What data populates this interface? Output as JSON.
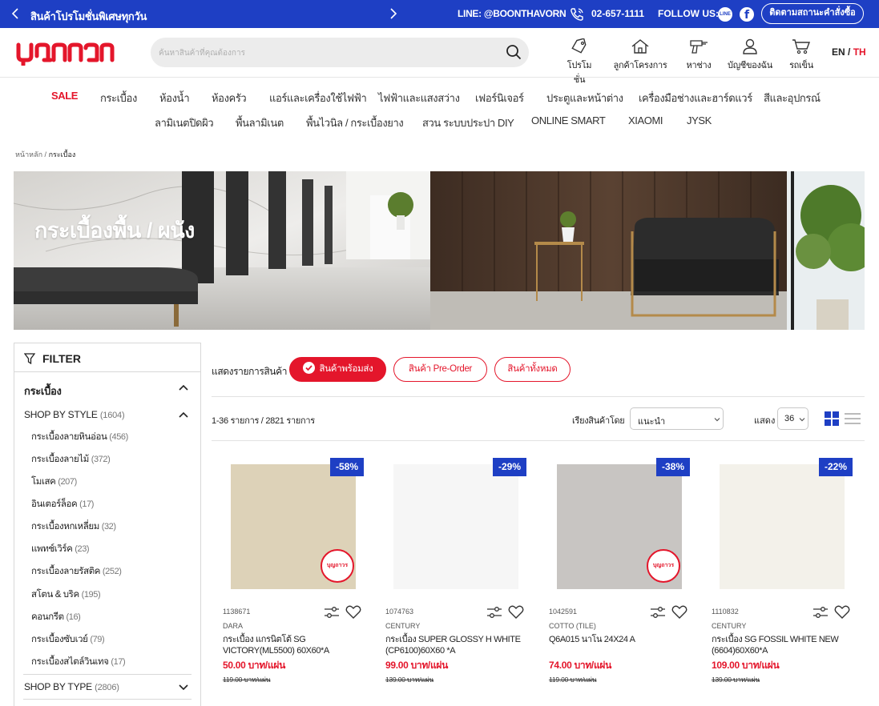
{
  "topbar": {
    "promo": "สินค้าโปรโมชั่นพิเศษทุกวัน",
    "line_id": "LINE: @BOONTHAVORN",
    "phone": "02-657-1111",
    "follow_label": "FOLLOW US:",
    "line_icon_text": "LINE",
    "track_order": "ติดตามสถานะคำสั่งซื้อ"
  },
  "header": {
    "logo_text": "บุญถาวร",
    "search_placeholder": "ค้นหาสินค้าที่คุณต้องการ",
    "items": [
      {
        "label": "โปรโมชั่น",
        "icon": "tag-icon"
      },
      {
        "label": "ลูกค้าโครงการ",
        "icon": "house-icon"
      },
      {
        "label": "หาช่าง",
        "icon": "drill-icon"
      },
      {
        "label": "บัญชีของฉัน",
        "icon": "user-icon"
      },
      {
        "label": "รถเข็น",
        "icon": "cart-icon"
      }
    ],
    "lang_en": "EN",
    "lang_sep": " / ",
    "lang_th": "TH"
  },
  "nav": {
    "row1": [
      "SALE",
      "กระเบื้อง",
      "ห้องน้ำ",
      "ห้องครัว",
      "แอร์และเครื่องใช้ไฟฟ้า",
      "ไฟฟ้าและแสงสว่าง",
      "เฟอร์นิเจอร์",
      "ประตูและหน้าต่าง",
      "เครื่องมือช่างและฮาร์ดแวร์",
      "สีและอุปกรณ์"
    ],
    "row2": [
      "ลามิเนตปิดผิว",
      "พื้นลามิเนต",
      "พื้นไวนิล / กระเบื้องยาง",
      "สวน ระบบประปา DIY",
      "ONLINE SMART",
      "XIAOMI",
      "JYSK"
    ]
  },
  "breadcrumb": {
    "home": "หน้าหลัก",
    "sep": " / ",
    "current": "กระเบื้อง"
  },
  "banner": {
    "title": "กระเบื้องพื้น / ผนัง"
  },
  "sidebar": {
    "filter_label": "FILTER",
    "category": "กระเบื้อง",
    "style_label": "SHOP BY STYLE",
    "style_count": "(1604)",
    "styles": [
      {
        "label": "กระเบื้องลายหินอ่อน",
        "count": "(456)"
      },
      {
        "label": "กระเบื้องลายไม้",
        "count": "(372)"
      },
      {
        "label": "โมเสค",
        "count": "(207)"
      },
      {
        "label": "อินเตอร์ล็อค",
        "count": "(17)"
      },
      {
        "label": "กระเบื้องหกเหลี่ยม",
        "count": "(32)"
      },
      {
        "label": "แพทช์เวิร์ค",
        "count": "(23)"
      },
      {
        "label": "กระเบื้องลายรัสติค",
        "count": "(252)"
      },
      {
        "label": "สโตน & บริค",
        "count": "(195)"
      },
      {
        "label": "คอนกรีต",
        "count": "(16)"
      },
      {
        "label": "กระเบื้องซับเวย์",
        "count": "(79)"
      },
      {
        "label": "กระเบื้องสไตล์วินเทจ",
        "count": "(17)"
      }
    ],
    "type_label": "SHOP BY TYPE",
    "type_count": "(2806)"
  },
  "availability": {
    "label": "แสดงรายการสินค้า",
    "options": [
      "สินค้าพร้อมส่ง",
      "สินค้า Pre-Order",
      "สินค้าทั้งหมด"
    ],
    "active": "สินค้าพร้อมส่ง"
  },
  "toolbar": {
    "count_text": "1-36 รายการ / 2821 รายการ",
    "sort_label": "เรียงสินค้าโดย",
    "sort_value": "แนะนำ",
    "show_label": "แสดง",
    "show_value": "36"
  },
  "products": [
    {
      "sku": "1138671",
      "brand": "DARA",
      "name": "กระเบื้อง แกรนิตโต้ SG VICTORY(ML5500) 60X60*A",
      "price": "50.00 บาท/แผ่น",
      "old_price": "119.00 บาท/แผ่น",
      "discount": "-58%",
      "color": "#ddd2b8",
      "stamp": true
    },
    {
      "sku": "1074763",
      "brand": "CENTURY",
      "name": "กระเบื้อง SUPER GLOSSY H WHITE (CP6100)60X60 *A",
      "price": "99.00 บาท/แผ่น",
      "old_price": "139.00 บาท/แผ่น",
      "discount": "-29%",
      "color": "#f6f6f6",
      "stamp": false
    },
    {
      "sku": "1042591",
      "brand": "COTTO (TILE)",
      "name": "Q6A015 นาโน 24X24 A",
      "price": "74.00 บาท/แผ่น",
      "old_price": "119.00 บาท/แผ่น",
      "discount": "-38%",
      "color": "#c8c5c2",
      "stamp": true
    },
    {
      "sku": "1110832",
      "brand": "CENTURY",
      "name": "กระเบื้อง SG FOSSIL WHITE NEW (6604)60X60*A",
      "price": "109.00 บาท/แผ่น",
      "old_price": "139.00 บาท/แผ่น",
      "discount": "-22%",
      "color": "#f3f1ea",
      "stamp": false
    }
  ],
  "stamp_text": "บุญถาวร",
  "colors": {
    "brand_blue": "#1e3fc4",
    "brand_red": "#e4162b"
  }
}
